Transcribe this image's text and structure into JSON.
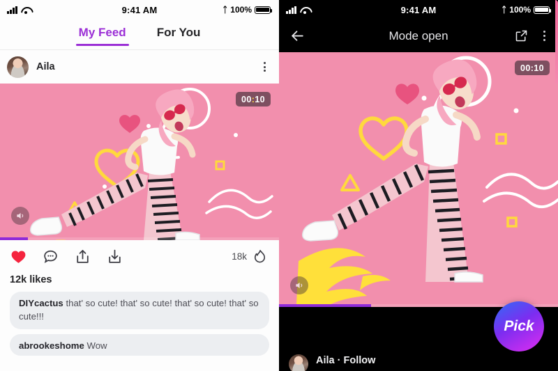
{
  "left_phone": {
    "status_bar": {
      "time": "9:41 AM",
      "battery_pct": "100%",
      "bluetooth_icon": "bluetooth-icon",
      "wifi_icon": "wifi-icon",
      "signal_icon": "signal-bars-icon",
      "battery_icon": "battery-icon"
    },
    "tabs": [
      {
        "label": "My Feed",
        "active": true
      },
      {
        "label": "For You",
        "active": false
      }
    ],
    "post": {
      "username": "Aila",
      "avatar_icon": "user-avatar",
      "more_icon": "more-vertical-icon",
      "timer": "00:10",
      "timer_minutes": "00",
      "timer_seconds": "10",
      "mute_icon": "speaker-mute-icon",
      "progress_pct": 10
    },
    "actions": {
      "like_icon": "heart-icon",
      "comment_icon": "comment-bubble-icon",
      "share_icon": "share-upload-icon",
      "save_icon": "download-icon",
      "fire_icon": "flame-icon",
      "fire_count": "18k"
    },
    "likes_label": "12k likes",
    "comments": [
      {
        "user": "DIYcactus",
        "text": "that' so cute! that' so cute! that' so cute! that' so cute!!!"
      },
      {
        "user": "abrookeshome",
        "text": "Wow"
      }
    ]
  },
  "right_phone": {
    "status_bar": {
      "time": "9:41 AM",
      "battery_pct": "100%"
    },
    "navbar": {
      "back_icon": "arrow-left-icon",
      "title": "Mode open",
      "share_icon": "external-link-icon",
      "more_icon": "more-vertical-icon"
    },
    "video": {
      "timer": "00:10",
      "timer_minutes": "00",
      "timer_seconds": "10",
      "mute_icon": "speaker-mute-icon",
      "progress_pct": 33
    },
    "pick_button": {
      "label": "Pick"
    },
    "bottom_user": {
      "label": "Aila · Follow",
      "avatar_icon": "user-avatar"
    }
  },
  "colors": {
    "accent_purple": "#9b2fd6",
    "pink_bg": "#f28fad",
    "heart_red": "#f5243e",
    "yellow": "#ffd93d",
    "dark": "#000000"
  }
}
